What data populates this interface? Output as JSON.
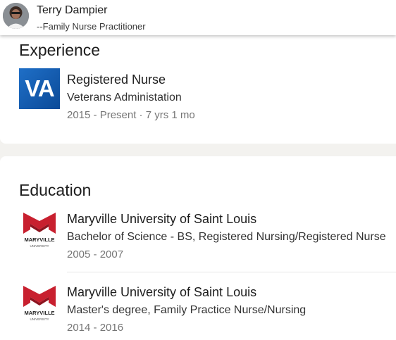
{
  "header": {
    "name": "Terry Dampier",
    "headline": "--Family Nurse Practitioner"
  },
  "experience": {
    "title": "Experience",
    "items": [
      {
        "logo_text": "VA",
        "role": "Registered Nurse",
        "organization": "Veterans Administation",
        "dates": "2015 - Present · 7 yrs 1 mo"
      }
    ]
  },
  "education": {
    "title": "Education",
    "items": [
      {
        "logo_text": "MARYVILLE",
        "logo_subtext": "UNIVERSITY",
        "school": "Maryville University of Saint Louis",
        "degree": "Bachelor of Science - BS, Registered Nursing/Registered Nurse",
        "dates": "2005 - 2007"
      },
      {
        "logo_text": "MARYVILLE",
        "logo_subtext": "UNIVERSITY",
        "school": "Maryville University of Saint Louis",
        "degree": "Master's degree, Family Practice Nurse/Nursing",
        "dates": "2014 - 2016"
      }
    ]
  },
  "colors": {
    "va_blue": "#1560bd",
    "maryville_red": "#c8202f",
    "page_background": "#f3f2ef"
  }
}
